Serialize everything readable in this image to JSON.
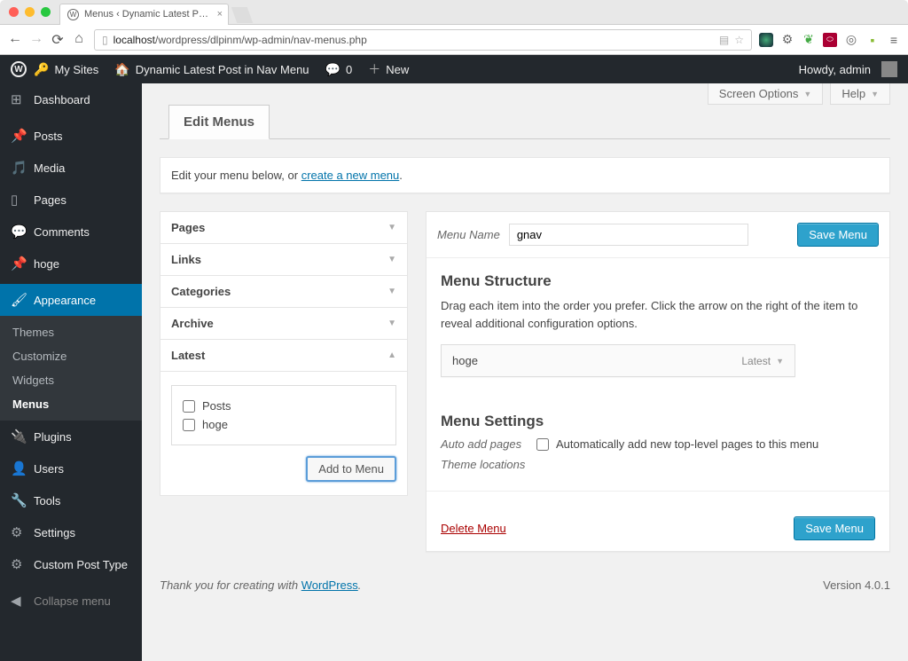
{
  "browser": {
    "tab_title": "Menus ‹ Dynamic Latest P…",
    "url_host": "localhost",
    "url_path": "/wordpress/dlpinm/wp-admin/nav-menus.php"
  },
  "adminbar": {
    "my_sites": "My Sites",
    "site_title": "Dynamic Latest Post in Nav Menu",
    "comments_count": "0",
    "new_label": "New",
    "howdy": "Howdy, admin"
  },
  "sidebar": {
    "dashboard": "Dashboard",
    "posts": "Posts",
    "media": "Media",
    "pages": "Pages",
    "comments": "Comments",
    "hoge": "hoge",
    "appearance": "Appearance",
    "themes": "Themes",
    "customize": "Customize",
    "widgets": "Widgets",
    "menus": "Menus",
    "plugins": "Plugins",
    "users": "Users",
    "tools": "Tools",
    "settings": "Settings",
    "cpt": "Custom Post Type",
    "collapse": "Collapse menu"
  },
  "screen": {
    "options": "Screen Options",
    "help": "Help"
  },
  "page": {
    "tab": "Edit Menus",
    "msg_pre": "Edit your menu below, or ",
    "msg_link": "create a new menu",
    "msg_post": "."
  },
  "accordion": {
    "pages": "Pages",
    "links": "Links",
    "categories": "Categories",
    "archive": "Archive",
    "latest": "Latest",
    "check_posts": "Posts",
    "check_hoge": "hoge",
    "add_btn": "Add to Menu"
  },
  "menu": {
    "name_label": "Menu Name",
    "name_value": "gnav",
    "save": "Save Menu",
    "structure_h": "Menu Structure",
    "structure_p": "Drag each item into the order you prefer. Click the arrow on the right of the item to reveal additional configuration options.",
    "item_label": "hoge",
    "item_type": "Latest",
    "settings_h": "Menu Settings",
    "auto_k": "Auto add pages",
    "auto_v": "Automatically add new top-level pages to this menu",
    "loc_k": "Theme locations",
    "delete": "Delete Menu"
  },
  "footer": {
    "thanks_pre": "Thank you for creating with ",
    "thanks_link": "WordPress",
    "thanks_post": ".",
    "version": "Version 4.0.1"
  }
}
